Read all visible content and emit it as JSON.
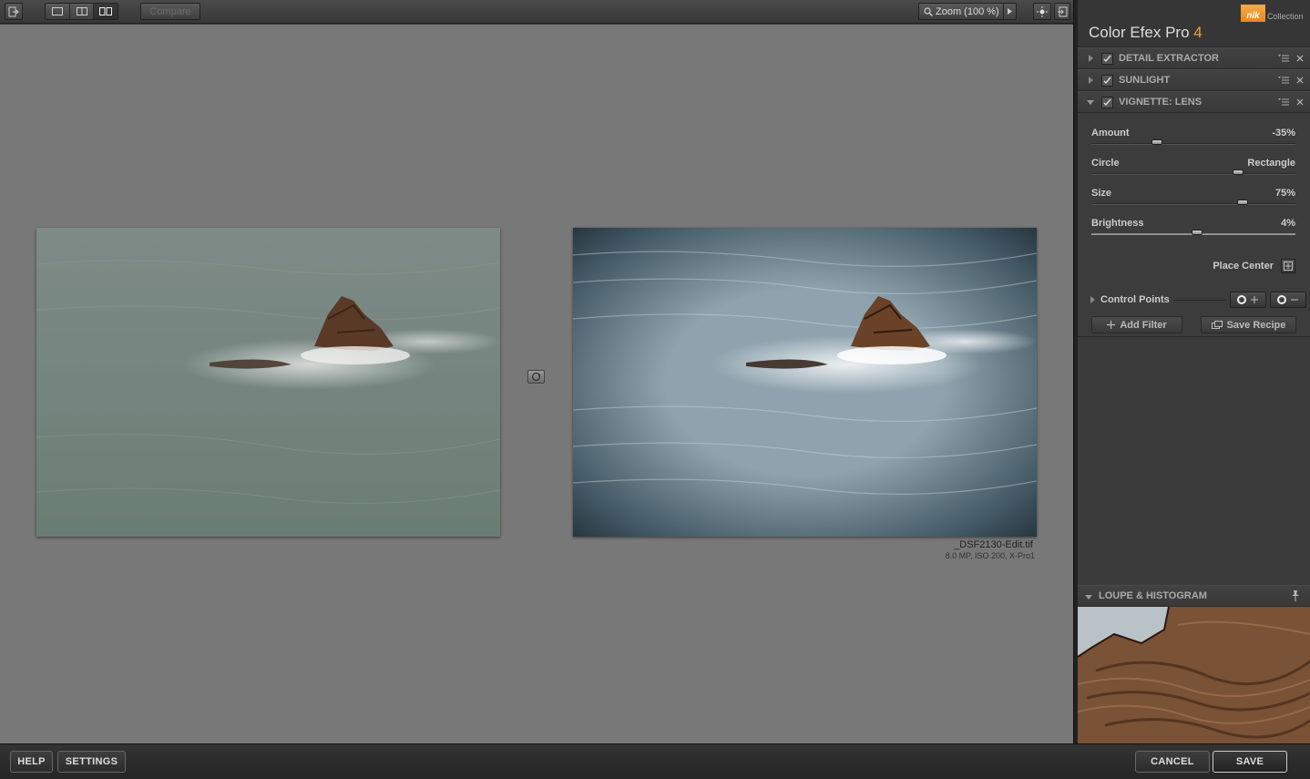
{
  "toolbar": {
    "compare_label": "Compare",
    "zoom_label": "Zoom (100 %)"
  },
  "canvas": {
    "file_name": "_DSF2130-Edit.tif",
    "file_meta": "8.0 MP, ISO 200, X-Pro1"
  },
  "panel": {
    "brand_logo": "nik",
    "brand_collection": "Collection",
    "app_name": "Color Efex Pro ",
    "app_version": "4",
    "filters": [
      {
        "name": "DETAIL EXTRACTOR",
        "enabled": true,
        "expanded": false
      },
      {
        "name": "SUNLIGHT",
        "enabled": true,
        "expanded": false
      },
      {
        "name": "VIGNETTE: LENS",
        "enabled": true,
        "expanded": true
      }
    ],
    "vignette": {
      "amount": {
        "label": "Amount",
        "value": "-35%",
        "level": 0.32
      },
      "shape": {
        "label": "Circle",
        "value": "Rectangle",
        "level": 0.72
      },
      "size": {
        "label": "Size",
        "value": "75%",
        "level": 0.74
      },
      "brightness": {
        "label": "Brightness",
        "value": "4%",
        "level": 0.52
      },
      "place_center": "Place Center",
      "control_points": "Control Points"
    },
    "add_filter": "Add Filter",
    "save_recipe": "Save Recipe",
    "loupe_title": "LOUPE & HISTOGRAM"
  },
  "bottom": {
    "help": "HELP",
    "settings": "SETTINGS",
    "cancel": "CANCEL",
    "save": "SAVE"
  },
  "colors": {
    "accent": "#f0a030",
    "canvas_bg": "#787878",
    "panel_bg": "#3b3b3b"
  }
}
